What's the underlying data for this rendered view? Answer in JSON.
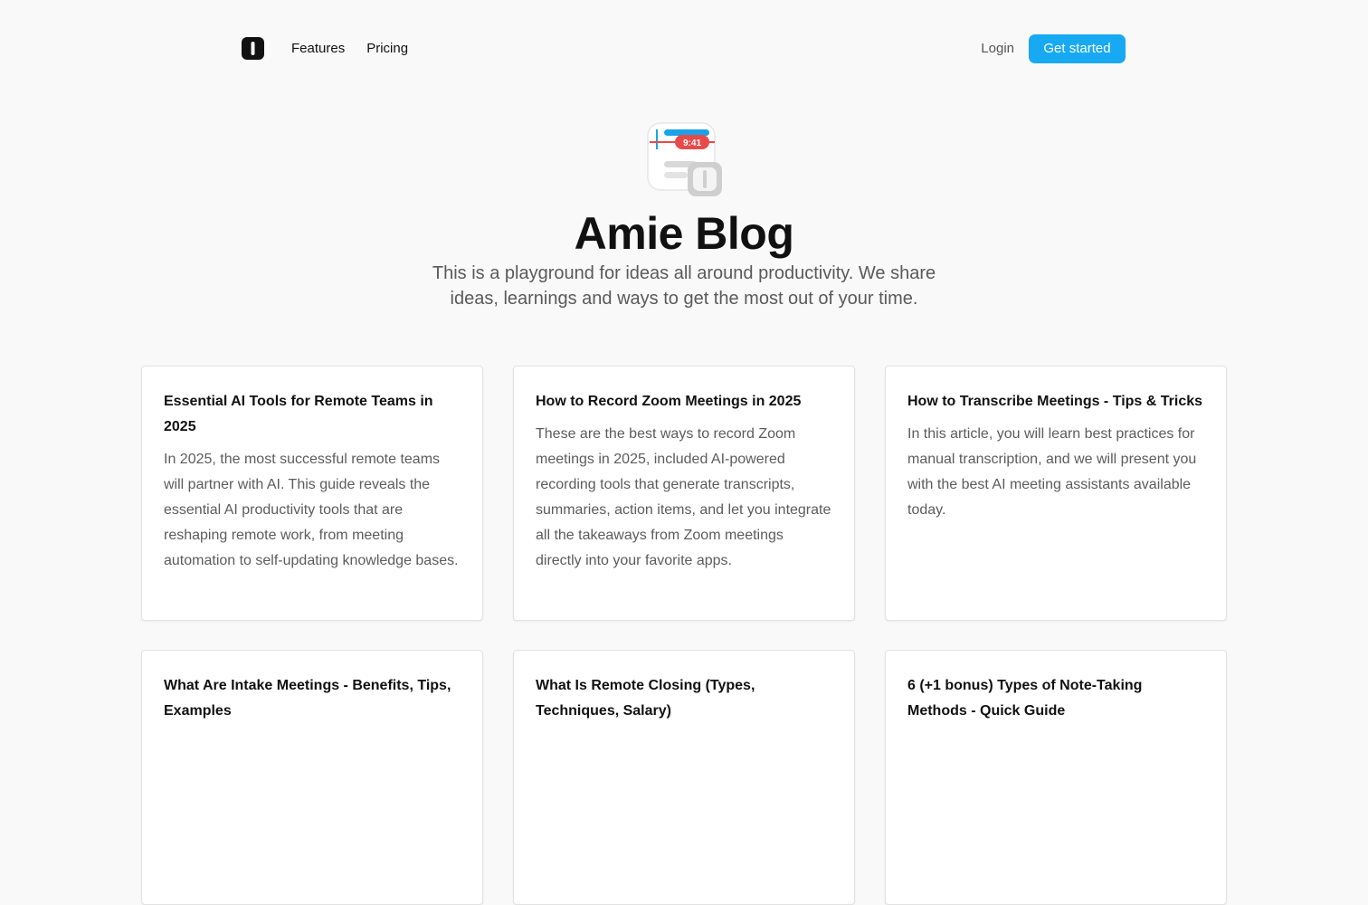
{
  "nav": {
    "links": [
      "Features",
      "Pricing"
    ],
    "login": "Login",
    "cta": "Get started"
  },
  "hero": {
    "icon_time": "9:41",
    "title": "Amie Blog",
    "subtitle": "This is a playground for ideas all around productivity. We share ideas, learnings and ways to get the most out of your time."
  },
  "posts": [
    {
      "title": "Essential AI Tools for Remote Teams in 2025",
      "description": "In 2025, the most successful remote teams will partner with AI. This guide reveals the essential AI productivity tools that are reshaping remote work, from meeting automation to self-updating knowledge bases."
    },
    {
      "title": "How to Record Zoom Meetings in 2025",
      "description": "These are the best ways to record Zoom meetings in 2025, included AI-powered recording tools that generate transcripts, summaries, action items, and let you integrate all the takeaways from Zoom meetings directly into your favorite apps."
    },
    {
      "title": "How to Transcribe Meetings - Tips & Tricks",
      "description": "In this article, you will learn best practices for manual transcription, and we will present you with the best AI meeting assistants available today."
    },
    {
      "title": "What Are Intake Meetings - Benefits, Tips, Examples",
      "description": ""
    },
    {
      "title": "What Is Remote Closing (Types, Techniques, Salary)",
      "description": ""
    },
    {
      "title": "6 (+1 bonus) Types of Note-Taking Methods - Quick Guide",
      "description": ""
    }
  ]
}
